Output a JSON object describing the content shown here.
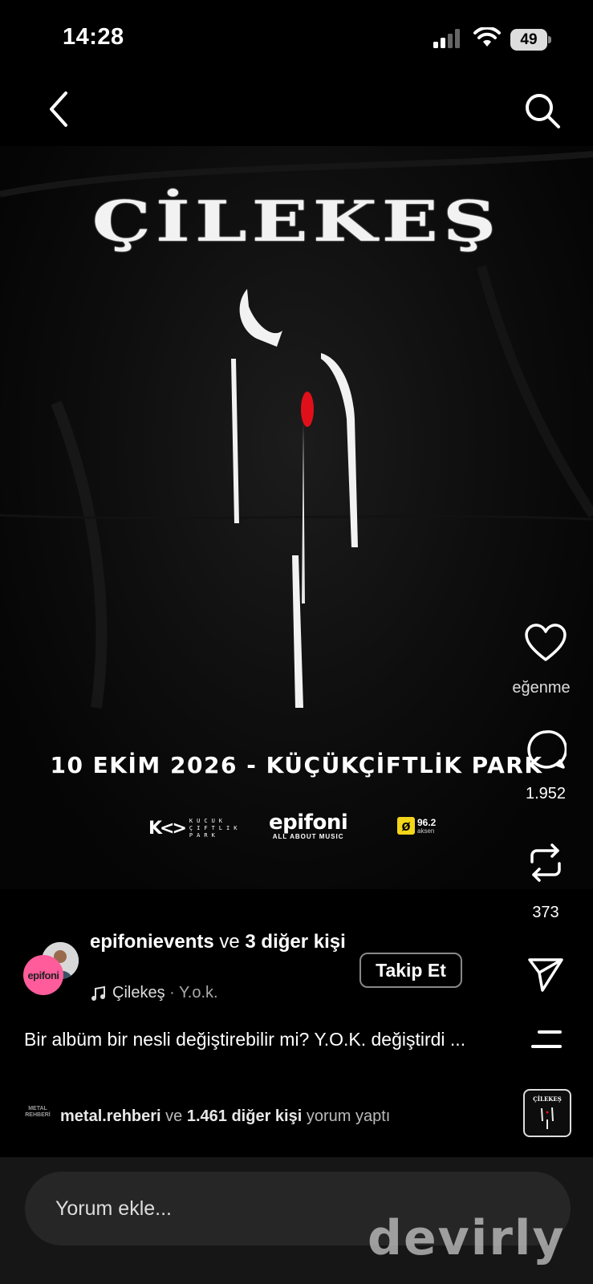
{
  "status_bar": {
    "time": "14:28",
    "battery": "49"
  },
  "poster": {
    "title": "ÇİLEKEŞ",
    "date_venue": "10 EKİM 2026 - KÜÇÜKÇİFTLİK PARK",
    "sponsors": {
      "kck_mark": "K<>",
      "kck_text": "KUCUK ÇIFTLIK PARK",
      "epifoni": "epifoni",
      "epifoni_tag": "ALL ABOUT MUSIC",
      "radio_freq": "96.2",
      "radio_name": "aksen"
    }
  },
  "actions": {
    "like_label": "Beğenme",
    "comment_count": "1.952",
    "repost_count": "373"
  },
  "author": {
    "avatar_text": "epifoni",
    "name": "epifonievents",
    "connector": " ve ",
    "others": "3 diğer kişi",
    "music_artist": "Çilekeş",
    "music_sep": " · ",
    "music_title": "Y.o.k.",
    "follow_label": "Takip Et"
  },
  "caption": "Bir albüm bir nesli değiştirebilir mi? Y.O.K. değiştirdi ...",
  "commenters": {
    "avatar_text": "METAL REHBERİ",
    "first": "metal.rehberi",
    "connector": " ve ",
    "others": "1.461 diğer kişi",
    "suffix": " yorum yaptı"
  },
  "comment_input": {
    "placeholder": "Yorum ekle..."
  },
  "audio_thumb_text": "ÇİLEKEŞ",
  "watermark": "devirly"
}
